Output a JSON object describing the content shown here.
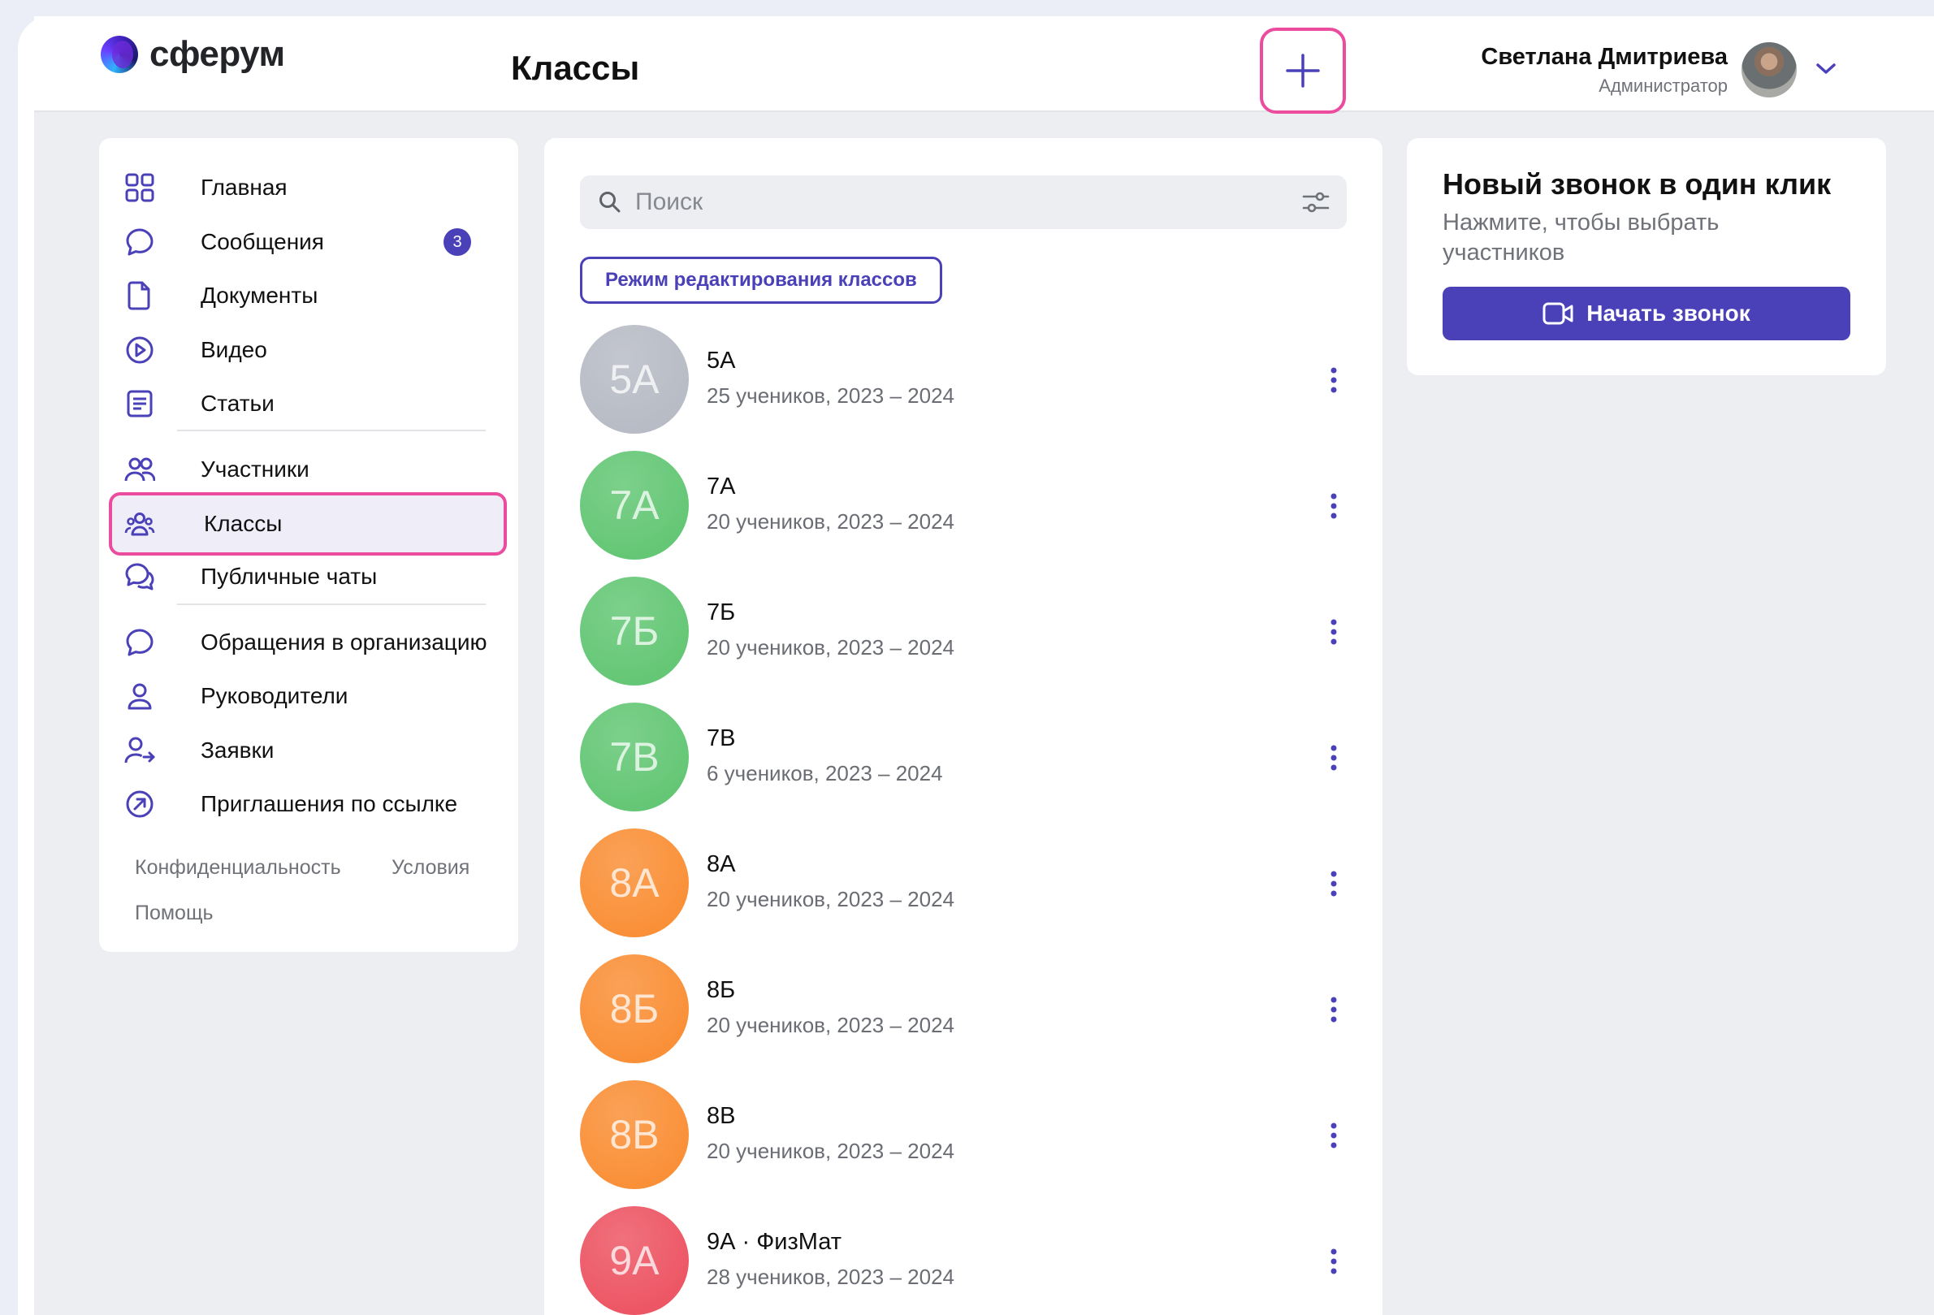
{
  "brand": {
    "name": "сферум"
  },
  "header": {
    "title": "Классы",
    "add_label": "+"
  },
  "user": {
    "name": "Светлана Дмитриева",
    "role": "Администратор"
  },
  "sidebar": {
    "items": [
      {
        "label": "Главная",
        "icon": "grid-icon"
      },
      {
        "label": "Сообщения",
        "icon": "chat-bubble-icon",
        "badge": "3"
      },
      {
        "label": "Документы",
        "icon": "document-icon"
      },
      {
        "label": "Видео",
        "icon": "play-circle-icon"
      },
      {
        "label": "Статьи",
        "icon": "article-icon"
      },
      {
        "label": "Участники",
        "icon": "users-icon"
      },
      {
        "label": "Классы",
        "icon": "group-icon",
        "active": true
      },
      {
        "label": "Публичные чаты",
        "icon": "chats-icon"
      },
      {
        "label": "Обращения в организацию",
        "icon": "chat-bubble-icon"
      },
      {
        "label": "Руководители",
        "icon": "person-icon"
      },
      {
        "label": "Заявки",
        "icon": "person-arrow-icon"
      },
      {
        "label": "Приглашения по ссылке",
        "icon": "link-arrow-icon"
      }
    ],
    "footer": {
      "privacy": "Конфиденциальность",
      "terms": "Условия",
      "help": "Помощь"
    }
  },
  "main": {
    "search_placeholder": "Поиск",
    "edit_mode_label": "Режим редактирования классов",
    "classes": [
      {
        "initials": "5А",
        "name": "5А",
        "meta": "25 учеников, 2023 – 2024",
        "color": "#b4b8c2"
      },
      {
        "initials": "7А",
        "name": "7А",
        "meta": "20 учеников,  2023 – 2024",
        "color": "#5cc46e"
      },
      {
        "initials": "7Б",
        "name": "7Б",
        "meta": "20 учеников,  2023 – 2024",
        "color": "#5cc46e"
      },
      {
        "initials": "7В",
        "name": "7В",
        "meta": "6 учеников,  2023 – 2024",
        "color": "#5cc46e"
      },
      {
        "initials": "8А",
        "name": "8А",
        "meta": "20 учеников,  2023 – 2024",
        "color": "#f98a2d"
      },
      {
        "initials": "8Б",
        "name": "8Б",
        "meta": "20 учеников,  2023 – 2024",
        "color": "#f98a2d"
      },
      {
        "initials": "8В",
        "name": "8В",
        "meta": "20 учеников,  2023 – 2024",
        "color": "#f98a2d"
      },
      {
        "initials": "9А",
        "name": "9А · ФизМат",
        "meta": "28 учеников, 2023 – 2024",
        "color": "#ec4d5c"
      }
    ]
  },
  "call_card": {
    "title": "Новый звонок в один клик",
    "subtitle": "Нажмите, чтобы выбрать участников",
    "button_label": "Начать звонок"
  },
  "colors": {
    "accent": "#4a40b8",
    "highlight": "#ec4c9e"
  }
}
